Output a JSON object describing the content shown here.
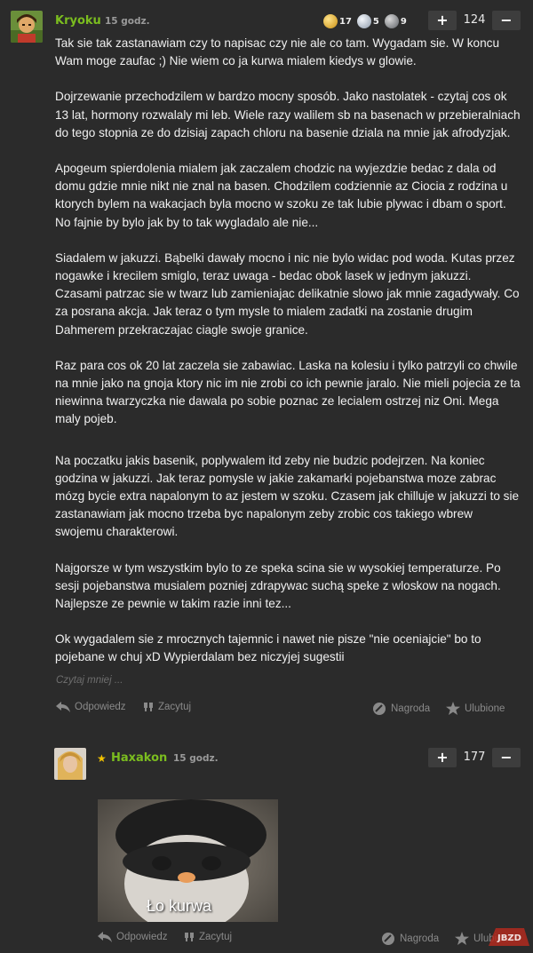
{
  "comment1": {
    "author": "Kryoku",
    "time": "15 godz.",
    "medals": [
      {
        "icon": "gold-medal-icon",
        "count": "17",
        "color": "#d6a92a"
      },
      {
        "icon": "silver-medal-icon",
        "count": "5",
        "color": "#b9c3cf"
      },
      {
        "icon": "platinum-medal-icon",
        "count": "9",
        "color": "#8f9398"
      }
    ],
    "plus_label": "+",
    "score": "124",
    "minus_label": "−",
    "paragraphs": [
      "Tak sie tak zastanawiam czy to napisac czy nie ale co tam. Wygadam sie. W koncu Wam moge zaufac ;) Nie wiem co ja kurwa mialem kiedys w glowie.",
      "Dojrzewanie przechodzilem w bardzo mocny sposób. Jako nastolatek - czytaj cos ok 13 lat, hormony rozwalaly mi leb. Wiele razy walilem sb na basenach w przebieralniach do tego stopnia ze do dzisiaj zapach chloru na basenie dziala na mnie jak afrodyzjak.",
      "Apogeum spierdolenia mialem jak zaczalem chodzic na wyjezdzie bedac z dala od domu gdzie mnie nikt nie znal na basen. Chodzilem codziennie az Ciocia z rodzina u ktorych bylem na wakacjach byla mocno w szoku ze tak lubie plywac i dbam o sport. No fajnie by bylo jak by to tak wygladalo ale nie...",
      "Siadalem w jakuzzi. Bąbelki dawały mocno i nic nie bylo widac pod woda. Kutas przez nogawke i krecilem smiglo, teraz uwaga - bedac obok lasek w jednym jakuzzi. Czasami patrzac sie w twarz lub zamieniajac delikatnie slowo jak mnie zagadywały. Co za posrana akcja. Jak teraz o tym mysle to mialem zadatki na zostanie drugim Dahmerem przekraczajac ciagle swoje granice.",
      "Raz para cos ok 20 lat zaczela sie zabawiac. Laska na kolesiu i tylko patrzyli co chwile na mnie jako na gnoja ktory nic im nie zrobi co ich pewnie jaralo. Nie mieli pojecia ze ta niewinna twarzyczka nie dawala po sobie poznac ze lecialem ostrzej niz Oni. Mega maly pojeb.",
      "Na poczatku jakis basenik, poplywalem itd zeby nie budzic podejrzen. Na koniec godzina w jakuzzi. Jak teraz pomysle w jakie zakamarki pojebanstwa moze zabrac mózg bycie extra napalonym to az jestem w szoku. Czasem jak chilluje w jakuzzi to sie zastanawiam jak mocno trzeba byc napalonym zeby zrobic cos takiego wbrew swojemu charakterowi.",
      "Najgorsze w tym wszystkim bylo to ze speka scina sie w wysokiej temperaturze. Po sesji pojebanstwa musialem pozniej zdrapywac suchą speke z wloskow na nogach. Najlepsze ze pewnie w takim razie inni tez...",
      "Ok wygadalem sie z mrocznych tajemnic i nawet nie pisze \"nie oceniajcie\" bo to pojebane w chuj xD Wypierdalam bez niczyjej sugestii"
    ],
    "read_less": "Czytaj mniej ...",
    "reply": "Odpowiedz",
    "quote": "Zacytuj",
    "award": "Nagroda",
    "favorite": "Ulubione"
  },
  "comment2": {
    "star": "★",
    "author": "Haxakon",
    "time": "15 godz.",
    "plus_label": "+",
    "score": "177",
    "minus_label": "−",
    "gif_caption": "Ło kurwa",
    "reply": "Odpowiedz",
    "quote": "Zacytuj",
    "award": "Nagroda",
    "favorite": "Ulubione"
  },
  "colors": {
    "background": "#2b2b2b",
    "author": "#7bbd1f",
    "star": "#f2c200",
    "button": "#3d3d3d"
  }
}
